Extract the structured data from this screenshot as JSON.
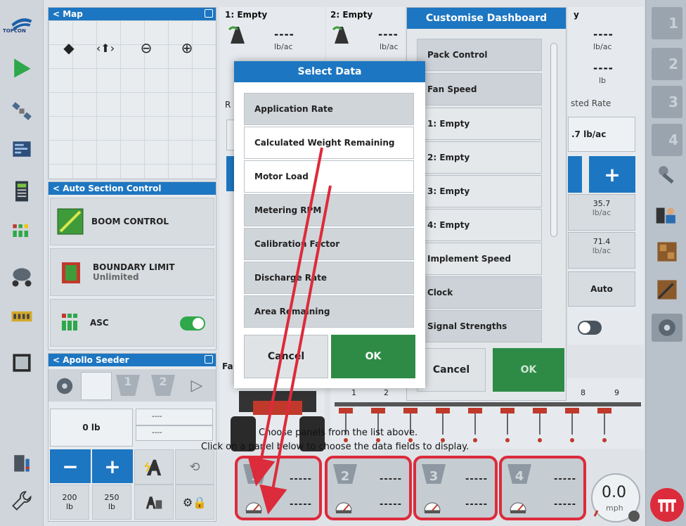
{
  "brand": {
    "logo_text": "TOPCON"
  },
  "map": {
    "title": "< Map"
  },
  "auto_section": {
    "title": "< Auto Section Control",
    "boom_control": "BOOM CONTROL",
    "boundary_limit": "BOUNDARY LIMIT",
    "boundary_sub": "Unlimited",
    "asc": "ASC"
  },
  "apollo": {
    "title": "< Apollo Seeder",
    "weight": "0 lb",
    "info1": "----",
    "info2": "----",
    "minus": "−",
    "plus": "+",
    "preset1_value": "200",
    "preset1_unit": "lb",
    "preset2_value": "250",
    "preset2_unit": "lb"
  },
  "dashboard": {
    "col1_title": "1: Empty",
    "col1_value": "----",
    "col1_unit": "lb/ac",
    "col2_title": "2: Empty",
    "col2_value": "----",
    "col2_unit": "lb/ac",
    "col4_title": "y",
    "col4_value": "----",
    "col4_unit": "lb/ac",
    "col4_value2": "----",
    "col4_unit2": "lb",
    "col4_label": "sted Rate",
    "col4_rate": ".7 lb/ac",
    "col4_plus": "+",
    "col4_v1": "35.7",
    "col4_v1u": "lb/ac",
    "col4_v2": "71.4",
    "col4_v2u": "lb/ac",
    "col4_auto": "Auto",
    "fa_label": "Fa",
    "r_label": "R",
    "row_numbers": [
      "1",
      "2",
      "8",
      "9"
    ]
  },
  "customise": {
    "title": "Customise Dashboard",
    "items": [
      "Pack Control",
      "Fan Speed",
      "1: Empty",
      "2: Empty",
      "3: Empty",
      "4: Empty",
      "Implement Speed",
      "Clock",
      "Signal Strengths"
    ],
    "cancel": "Cancel",
    "ok": "OK"
  },
  "select_data": {
    "title": "Select Data",
    "items": [
      "Application Rate",
      "Calculated Weight Remaining",
      "Motor Load",
      "Metering RPM",
      "Calibration Factor",
      "Discharge Rate",
      "Area Remaining"
    ],
    "cancel": "Cancel",
    "ok": "OK"
  },
  "instructions": {
    "line1": "Choose panels from the list above.",
    "line2": "Click on a panel below to choose the data fields to display."
  },
  "tiles": [
    {
      "num": "1",
      "top": "-----",
      "bottom": "-----"
    },
    {
      "num": "2",
      "top": "-----",
      "bottom": "-----"
    },
    {
      "num": "3",
      "top": "-----",
      "bottom": "-----"
    },
    {
      "num": "4",
      "top": "-----",
      "bottom": "-----"
    }
  ],
  "speed": {
    "value": "0.0",
    "unit": "mph"
  },
  "right_tabs": [
    "1",
    "2",
    "3",
    "4"
  ],
  "colors": {
    "accent": "#1d76c1",
    "ok_green": "#2e8b45",
    "highlight_red": "#dc2b3b"
  }
}
